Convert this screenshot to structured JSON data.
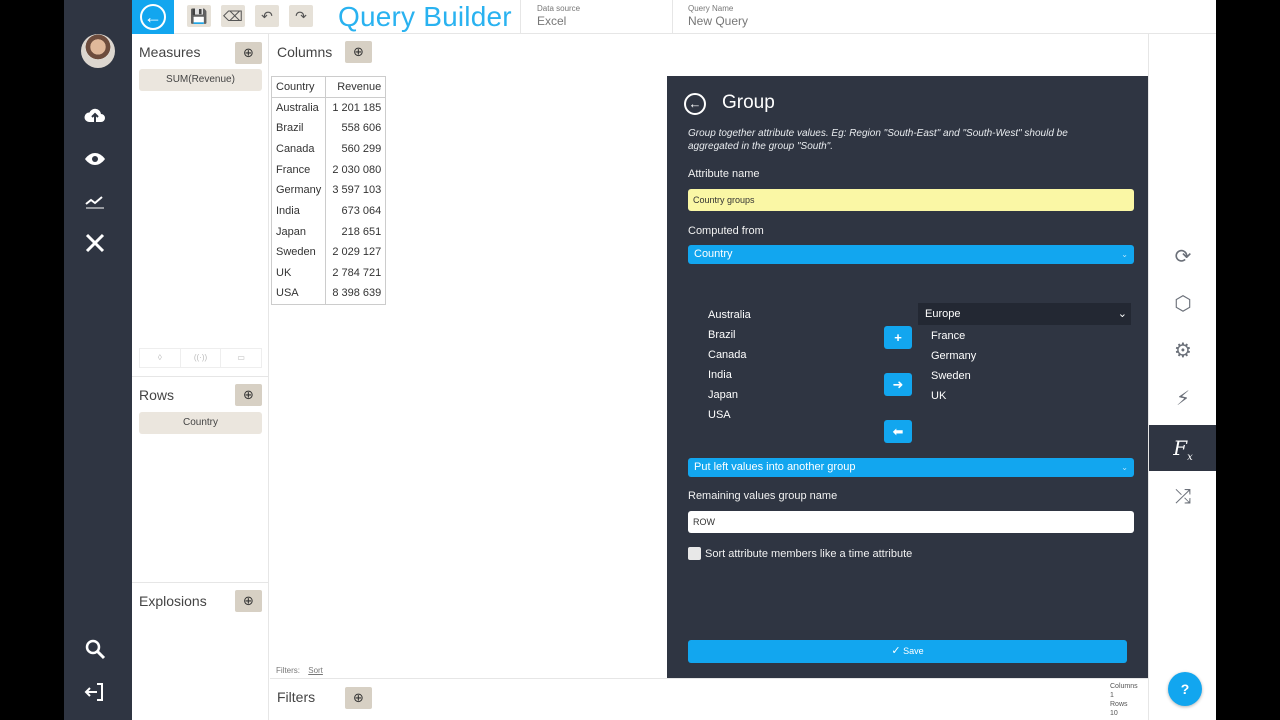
{
  "topbar": {
    "title": "Query Builder",
    "datasource_label": "Data source",
    "datasource_value": "Excel",
    "queryname_label": "Query Name",
    "queryname_value": "New Query"
  },
  "left_panel": {
    "measures_title": "Measures",
    "measures_items": [
      "SUM(Revenue)"
    ],
    "rows_title": "Rows",
    "rows_items": [
      "Country"
    ],
    "explosions_title": "Explosions"
  },
  "columns": {
    "title": "Columns"
  },
  "table": {
    "headers": [
      "Country",
      "Revenue"
    ],
    "rows": [
      [
        "Australia",
        "1 201 185"
      ],
      [
        "Brazil",
        "558 606"
      ],
      [
        "Canada",
        "560 299"
      ],
      [
        "France",
        "2 030 080"
      ],
      [
        "Germany",
        "3 597 103"
      ],
      [
        "India",
        "673 064"
      ],
      [
        "Japan",
        "218 651"
      ],
      [
        "Sweden",
        "2 029 127"
      ],
      [
        "UK",
        "2 784 721"
      ],
      [
        "USA",
        "8 398 639"
      ]
    ]
  },
  "filters_note": {
    "label": "Filters:",
    "sort": "Sort"
  },
  "bottom": {
    "filters_title": "Filters",
    "stats_columns_label": "Columns",
    "stats_columns_value": "1",
    "stats_rows_label": "Rows",
    "stats_rows_value": "10"
  },
  "dialog": {
    "title": "Group",
    "description": "Group together attribute values. Eg: Region \"South-East\" and \"South-West\" should be aggregated in the group \"South\".",
    "attr_label": "Attribute name",
    "attr_value": "Country groups",
    "computed_label": "Computed from",
    "computed_value": "Country",
    "left_values": [
      "Australia",
      "Brazil",
      "Canada",
      "India",
      "Japan",
      "USA"
    ],
    "group_name": "Europe",
    "group_values": [
      "France",
      "Germany",
      "Sweden",
      "UK"
    ],
    "left_option": "Put left values into another group",
    "remaining_label": "Remaining values group name",
    "remaining_value": "ROW",
    "sort_label": "Sort attribute members like a time attribute",
    "save_label": "Save"
  },
  "colors": {
    "accent": "#12a6ef",
    "dark": "#2f3542",
    "yellow_input": "#faf7a5"
  }
}
